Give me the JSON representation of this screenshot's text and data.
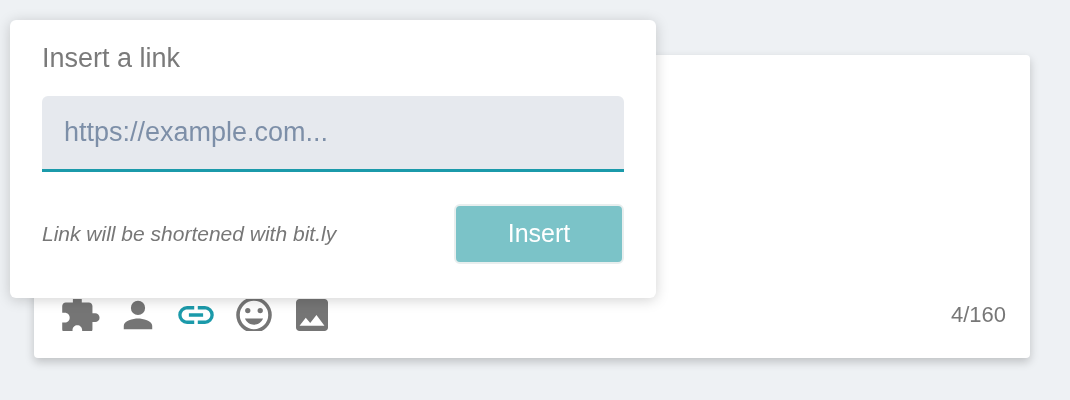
{
  "popover": {
    "title": "Insert a link",
    "url_field": {
      "placeholder": "https://example.com...",
      "focused": true
    },
    "note": "Link will be shortened with bit.ly",
    "insert_button": {
      "label": "Insert",
      "disabled": true
    }
  },
  "composer": {
    "toolbar": [
      {
        "kind": "puzzle",
        "selected": false
      },
      {
        "kind": "person",
        "selected": false
      },
      {
        "kind": "link",
        "selected": true
      },
      {
        "kind": "smiley",
        "selected": false
      },
      {
        "kind": "image",
        "selected": false
      }
    ],
    "counter": "4/160"
  }
}
